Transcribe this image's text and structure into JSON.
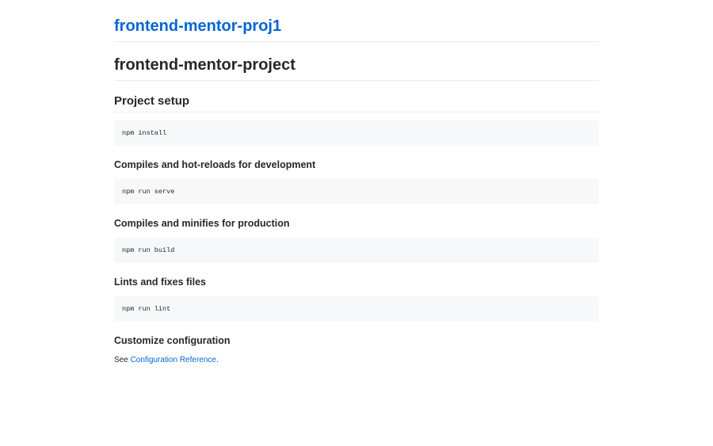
{
  "header": {
    "site_title": "frontend-mentor-proj1"
  },
  "readme": {
    "title": "frontend-mentor-project",
    "project_setup": {
      "heading": "Project setup",
      "command": "npm install"
    },
    "sections": [
      {
        "heading": "Compiles and hot-reloads for development",
        "command": "npm run serve"
      },
      {
        "heading": "Compiles and minifies for production",
        "command": "npm run build"
      },
      {
        "heading": "Lints and fixes files",
        "command": "npm run lint"
      }
    ],
    "customize": {
      "heading": "Customize configuration",
      "see_prefix": "See ",
      "link_text": "Configuration Reference",
      "see_suffix": "."
    }
  },
  "colors": {
    "link": "#0366d6",
    "text": "#24292e",
    "code_bg": "#f6f8fa",
    "divider": "#eaecef"
  }
}
